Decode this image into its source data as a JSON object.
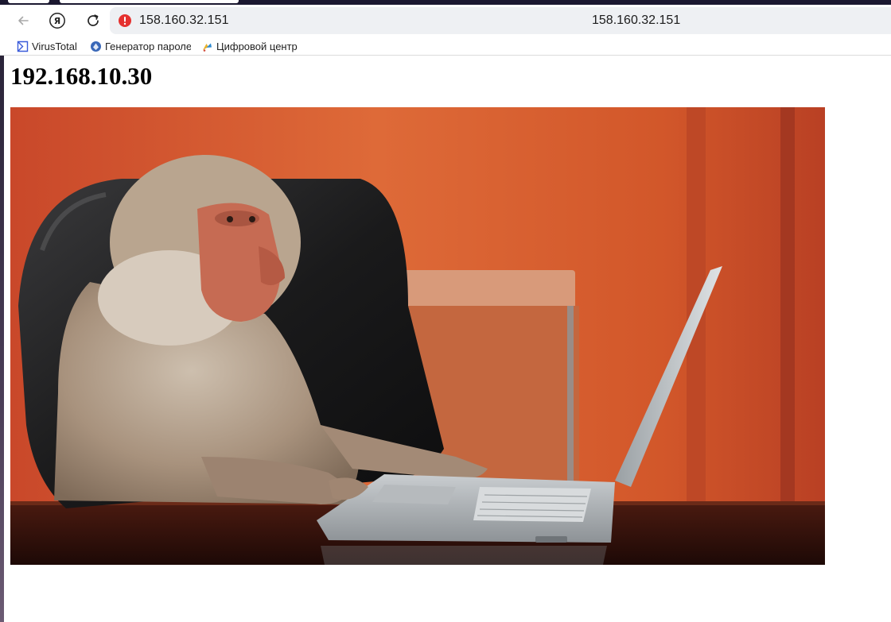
{
  "browser": {
    "address_url": "158.160.32.151",
    "window_title": "158.160.32.151",
    "security_state": "not-secure",
    "ya_button_label": "Я",
    "icons": {
      "back": "back-arrow-icon",
      "ya": "yandex-icon",
      "reload": "reload-icon",
      "security": "alert-icon"
    }
  },
  "bookmarks": [
    {
      "label": "VirusTotal",
      "icon": "virustotal-icon"
    },
    {
      "label": "Генератор пароле",
      "icon": "password-generator-icon"
    },
    {
      "label": "Цифровой центр",
      "icon": "digital-center-icon"
    }
  ],
  "page": {
    "heading": "192.168.10.30",
    "image_subject": "baboon sitting in a leather office chair typing on a laptop"
  },
  "colors": {
    "security_alert": "#e5312f",
    "virustotal_blue": "#3a5bd9",
    "wall_orange": "#d2572a"
  }
}
